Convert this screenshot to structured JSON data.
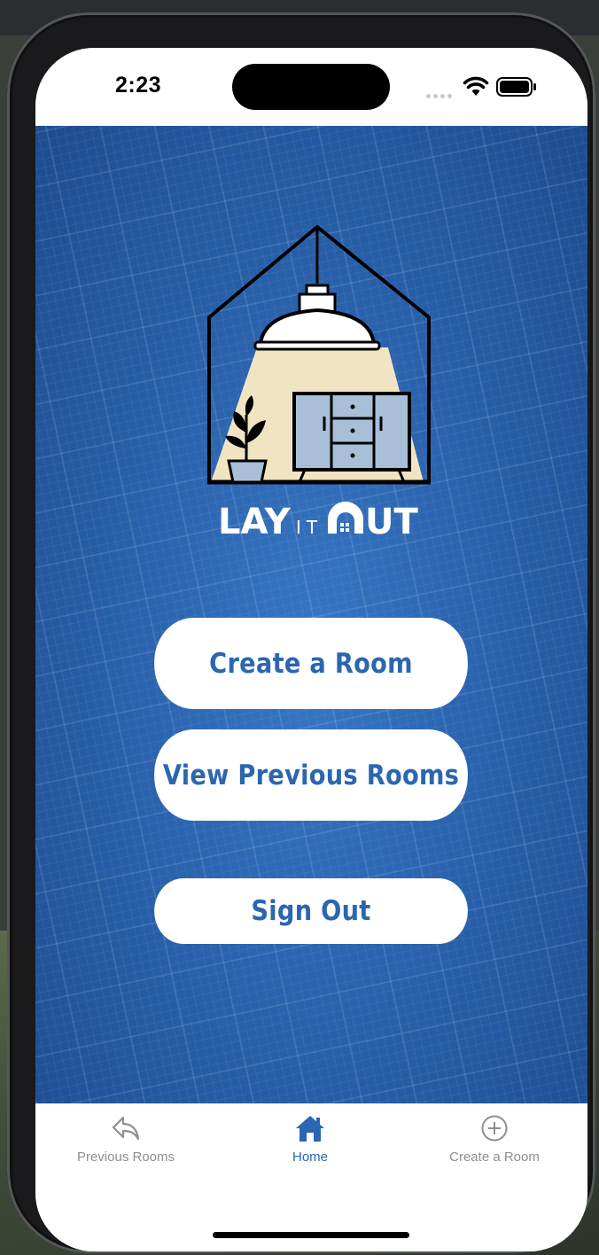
{
  "status_bar": {
    "time": "2:23"
  },
  "logo": {
    "wordmark_left": "LAY",
    "wordmark_mid": "IT",
    "wordmark_right": "UT"
  },
  "buttons": {
    "create_room": "Create a Room",
    "view_previous": "View Previous Rooms",
    "sign_out": "Sign Out"
  },
  "tabbar": {
    "tabs": [
      {
        "label": "Previous Rooms",
        "icon": "reply-arrow-icon",
        "active": false
      },
      {
        "label": "Home",
        "icon": "house-icon",
        "active": true
      },
      {
        "label": "Create a Room",
        "icon": "plus-circle-icon",
        "active": false
      }
    ]
  },
  "colors": {
    "accent": "#2b66b1",
    "background_blue": "#2a62ad",
    "tab_inactive": "#8e8e93",
    "lamp_light": "#f1e4c3",
    "cabinet": "#a9bfd8"
  }
}
